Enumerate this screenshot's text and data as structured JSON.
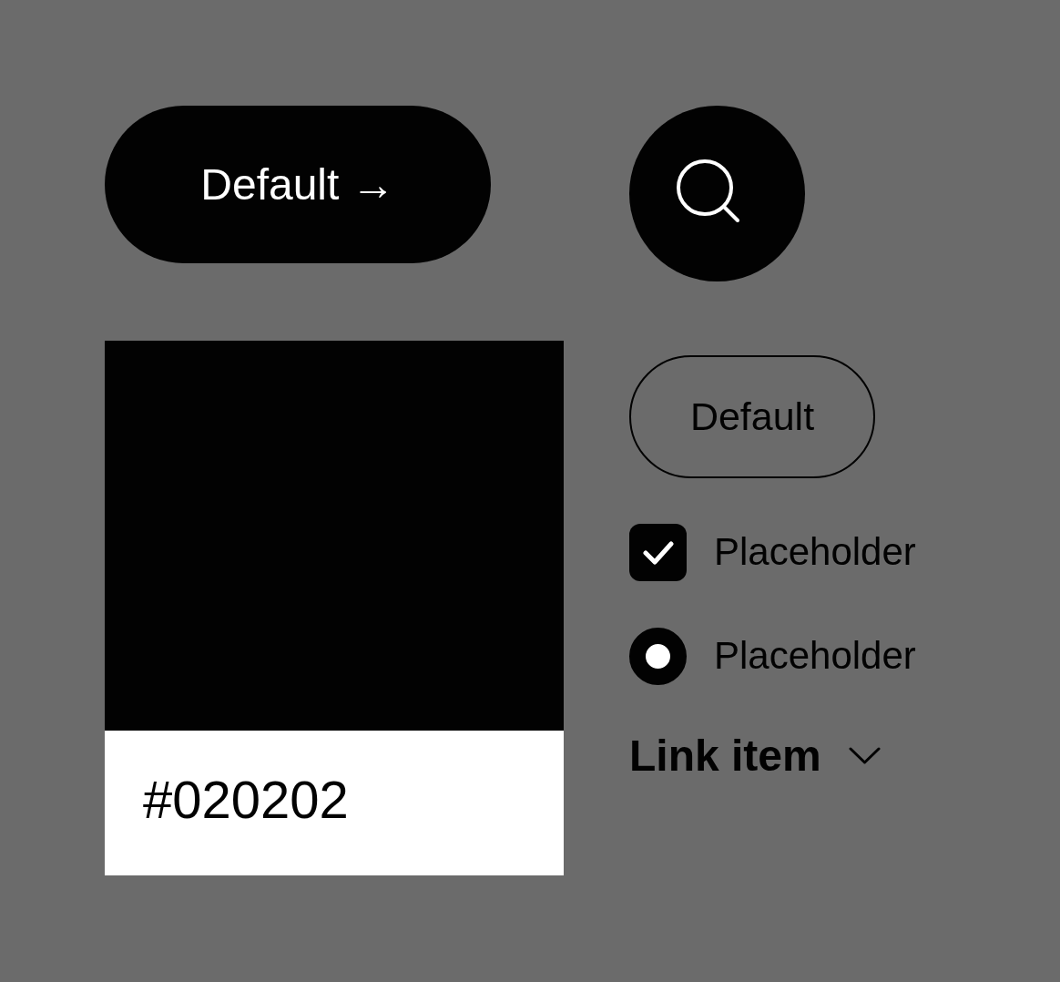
{
  "primary_button": {
    "label": "Default →"
  },
  "swatch": {
    "color": "#020202",
    "label": "#020202"
  },
  "secondary_button": {
    "label": "Default"
  },
  "options": [
    {
      "kind": "checkbox",
      "label": "Placeholder",
      "checked": true
    },
    {
      "kind": "radio",
      "label": "Placeholder",
      "selected": true
    }
  ],
  "link": {
    "label": "Link item"
  }
}
